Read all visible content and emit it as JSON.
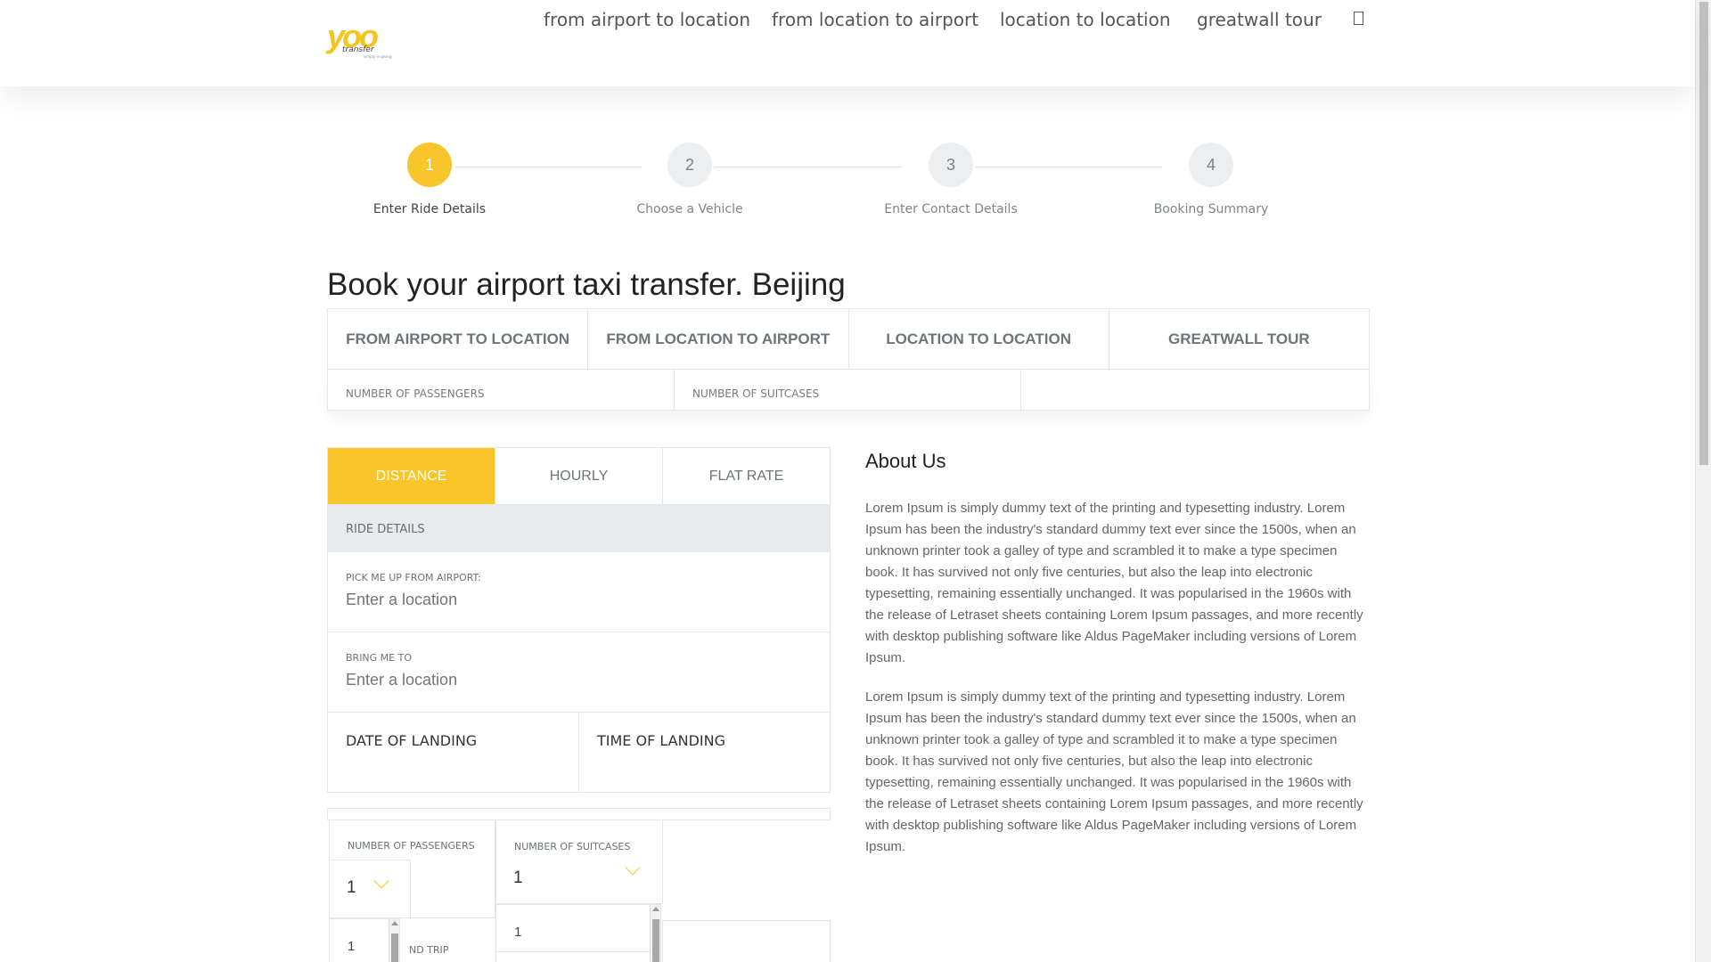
{
  "header": {
    "logo": {
      "main": "yoo",
      "sub": "transfer",
      "tagline": "simply in giving"
    },
    "nav": [
      "from airport to location",
      "from location to airport",
      "location to location",
      "greatwall tour"
    ],
    "more_icon": "square-icon"
  },
  "steps": [
    {
      "number": "1",
      "label": "Enter Ride Details",
      "active": true
    },
    {
      "number": "2",
      "label": "Choose a Vehicle",
      "active": false
    },
    {
      "number": "3",
      "label": "Enter Contact Details",
      "active": false
    },
    {
      "number": "4",
      "label": "Booking Summary",
      "active": false
    }
  ],
  "page_title": "Book your airport taxi transfer. Beijing",
  "trip_tabs": [
    "FROM AIRPORT TO LOCATION",
    "FROM LOCATION TO AIRPORT",
    "LOCATION TO LOCATION",
    "GREATWALL TOUR"
  ],
  "summary": {
    "passengers_label": "NUMBER OF PASSENGERS",
    "suitcases_label": "NUMBER OF SUITCASES"
  },
  "rate_tabs": [
    "DISTANCE",
    "HOURLY",
    "FLAT RATE"
  ],
  "form": {
    "section_title": "RIDE DETAILS",
    "pickup_label": "PICK ME UP FROM AIRPORT:",
    "pickup_placeholder": "Enter a location",
    "dropoff_label": "BRING ME TO",
    "dropoff_placeholder": "Enter a location",
    "date_label": "DATE OF LANDING",
    "time_label": "TIME OF LANDING",
    "passengers_label": "NUMBER OF PASSENGERS",
    "passengers_value": "1",
    "passengers_option": "1",
    "suitcases_label": "NUMBER OF SUITCASES",
    "suitcases_value": "1",
    "suitcases_option": "1",
    "round_trip_label": "ND TRIP"
  },
  "about": {
    "title": "About Us",
    "paragraphs": [
      "Lorem Ipsum is simply dummy text of the printing and typesetting industry. Lorem Ipsum has been the industry's standard dummy text ever since the 1500s, when an unknown printer took a galley of type and scrambled it to make a type specimen book. It has survived not only five centuries, but also the leap into electronic typesetting, remaining essentially unchanged. It was popularised in the 1960s with the release of Letraset sheets containing Lorem Ipsum passages, and more recently with desktop publishing software like Aldus PageMaker including versions of Lorem Ipsum.",
      "Lorem Ipsum is simply dummy text of the printing and typesetting industry. Lorem Ipsum has been the industry's standard dummy text ever since the 1500s, when an unknown printer took a galley of type and scrambled it to make a type specimen book. It has survived not only five centuries, but also the leap into electronic typesetting, remaining essentially unchanged. It was popularised in the 1960s with the release of Letraset sheets containing Lorem Ipsum passages, and more recently with desktop publishing software like Aldus PageMaker including versions of Lorem Ipsum."
    ]
  },
  "colors": {
    "accent": "#f8c52a",
    "text": "#333333",
    "muted": "#6f747a"
  }
}
